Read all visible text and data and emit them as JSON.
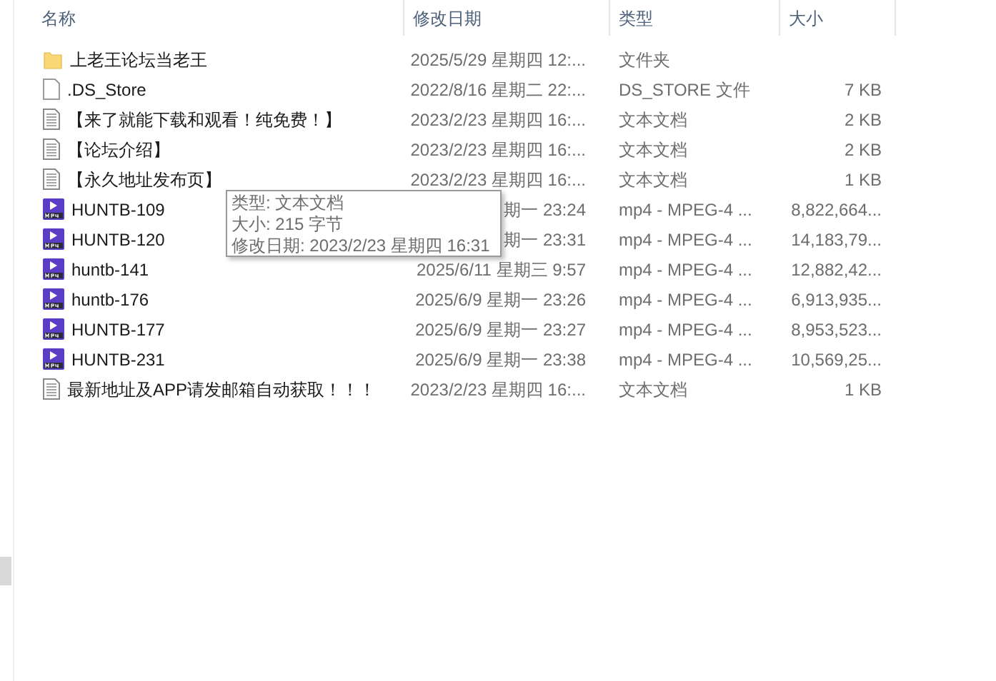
{
  "columns": [
    {
      "label": "名称"
    },
    {
      "label": "修改日期"
    },
    {
      "label": "类型"
    },
    {
      "label": "大小"
    }
  ],
  "rows": [
    {
      "kind": "folder",
      "name": "上老王论坛当老王",
      "date": "2025/5/29 星期四 12:...",
      "type": "文件夹"
    },
    {
      "kind": "file",
      "name": ".DS_Store",
      "date": "2022/8/16 星期二 22:...",
      "type": "DS_STORE 文件",
      "size": "7 KB"
    },
    {
      "kind": "text",
      "name": "【来了就能下载和观看！纯免费！】",
      "date": "2023/2/23 星期四 16:...",
      "type": "文本文档",
      "size": "2 KB"
    },
    {
      "kind": "text",
      "name": "【论坛介绍】",
      "date": "2023/2/23 星期四 16:...",
      "type": "文本文档",
      "size": "2 KB"
    },
    {
      "kind": "text",
      "name": "【永久地址发布页】",
      "date": "2023/2/23 星期四 16:...",
      "type": "文本文档",
      "size": "1 KB"
    },
    {
      "kind": "video",
      "name": "HUNTB-109",
      "date": "期一 23:24",
      "type": "mp4 - MPEG-4 ...",
      "size": "8,822,664..."
    },
    {
      "kind": "video",
      "name": "HUNTB-120",
      "date": "期一 23:31",
      "type": "mp4 - MPEG-4 ...",
      "size": "14,183,79..."
    },
    {
      "kind": "video",
      "name": "huntb-141",
      "date": "2025/6/11 星期三 9:57",
      "type": "mp4 - MPEG-4 ...",
      "size": "12,882,42..."
    },
    {
      "kind": "video",
      "name": "huntb-176",
      "date": "2025/6/9 星期一 23:26",
      "type": "mp4 - MPEG-4 ...",
      "size": "6,913,935..."
    },
    {
      "kind": "video",
      "name": "HUNTB-177",
      "date": "2025/6/9 星期一 23:27",
      "type": "mp4 - MPEG-4 ...",
      "size": "8,953,523..."
    },
    {
      "kind": "video",
      "name": "HUNTB-231",
      "date": "2025/6/9 星期一 23:38",
      "type": "mp4 - MPEG-4 ...",
      "size": "10,569,25..."
    },
    {
      "kind": "text",
      "name": "最新地址及APP请发邮箱自动获取！！！",
      "date": "2023/2/23 星期四 16:...",
      "type": "文本文档",
      "size": "1 KB"
    }
  ],
  "tooltip": {
    "lines": [
      "类型: 文本文档",
      "大小: 215 字节",
      "修改日期: 2023/2/23 星期四 16:31"
    ]
  }
}
